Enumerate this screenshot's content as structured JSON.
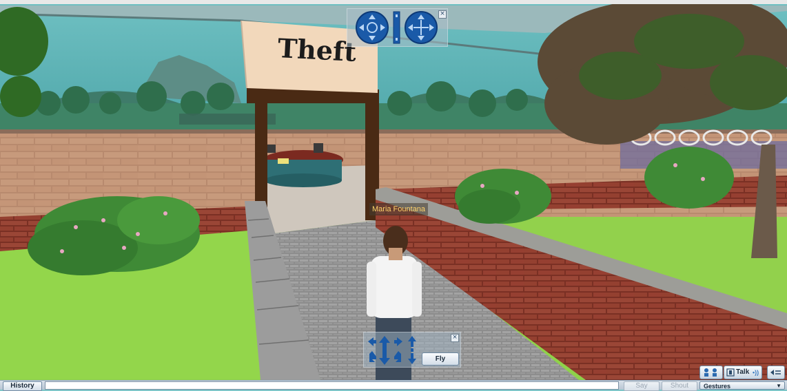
{
  "scene": {
    "sign_text": "Theft",
    "avatar_name": "Maria Fountana"
  },
  "camera_controls": {
    "close_label": "×",
    "icons": [
      "orbit-icon",
      "zoom-slider-icon",
      "pan-icon"
    ]
  },
  "movement_controls": {
    "close_label": "×",
    "fly_label": "Fly",
    "icons": [
      "turn-left-icon",
      "move-forward-icon",
      "turn-right-icon",
      "move-up-down-icon"
    ]
  },
  "chat_bar": {
    "history_label": "History",
    "input_value": "",
    "say_label": "Say",
    "shout_label": "Shout",
    "gestures_label": "Gestures"
  },
  "voice_bar": {
    "talk_label": "Talk",
    "icons": [
      "active-speakers-icon",
      "talk-icon",
      "voice-settings-icon"
    ]
  },
  "colors": {
    "sky": "#7ec6c8",
    "grass": "#8fd24a",
    "brick": "#b8876a",
    "sign_bg": "#f4dcc0",
    "door_frame": "#4a2a14",
    "nametag_text": "#ffd36b",
    "ui_blue": "#1a5aa8"
  }
}
